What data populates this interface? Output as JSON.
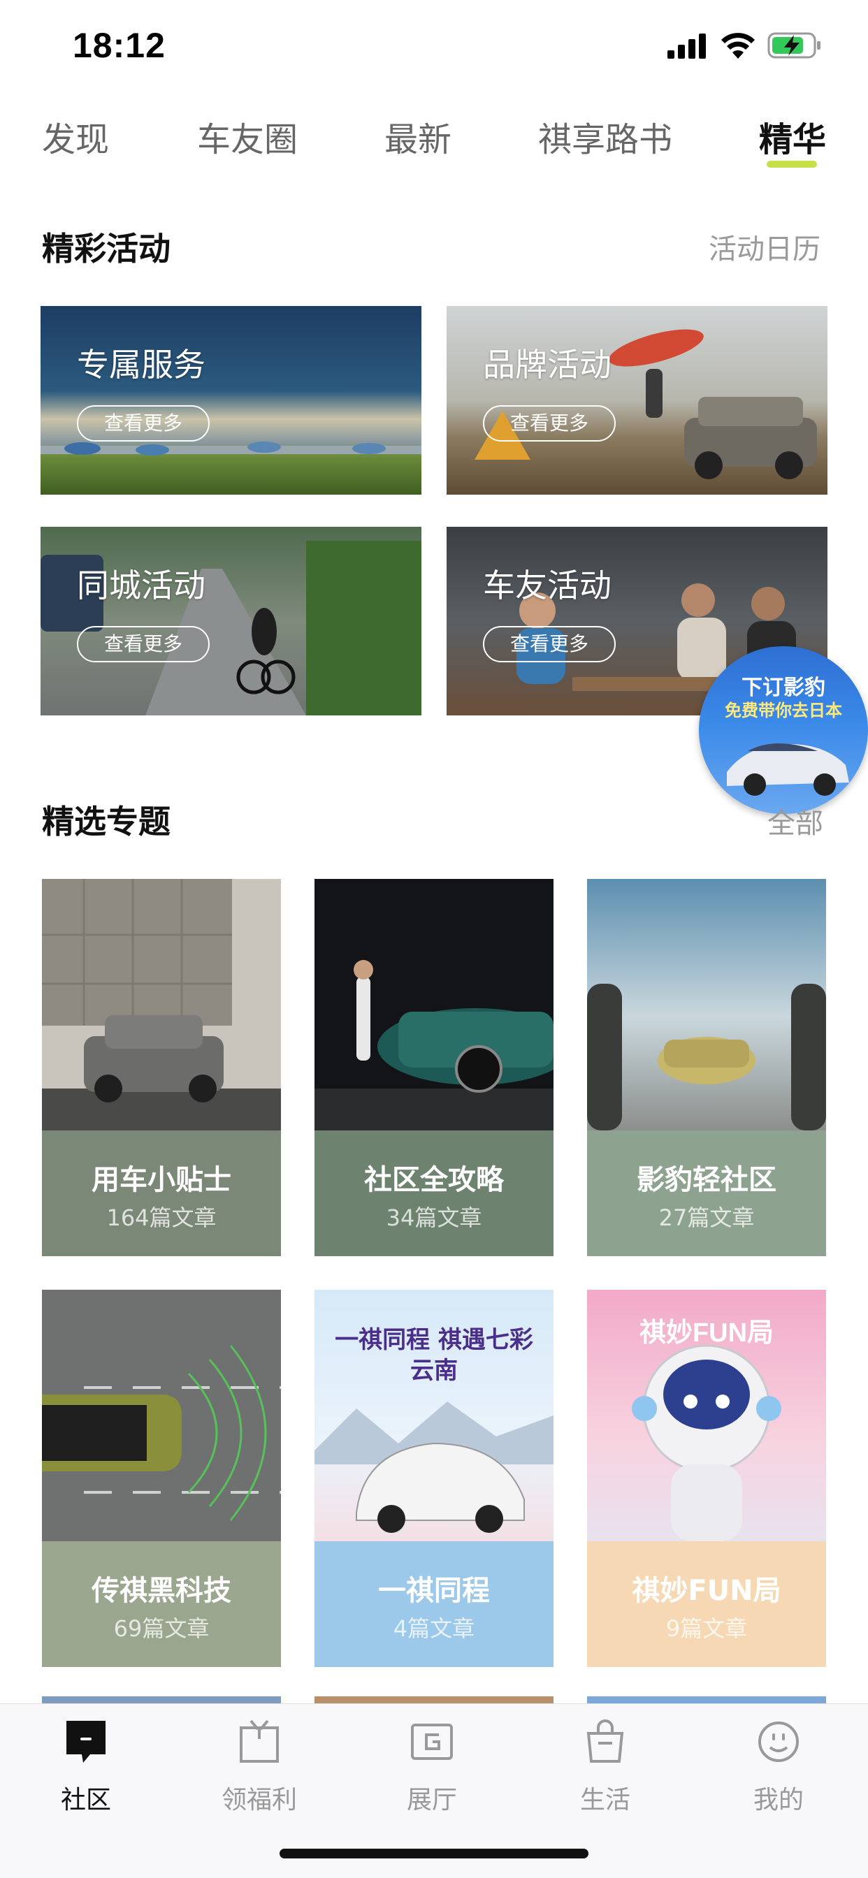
{
  "status_bar": {
    "time": "18:12"
  },
  "top_tabs": [
    {
      "label": "发现"
    },
    {
      "label": "车友圈"
    },
    {
      "label": "最新"
    },
    {
      "label": "祺享路书"
    },
    {
      "label": "精华",
      "active": true
    }
  ],
  "activities_section": {
    "title": "精彩活动",
    "link": "活动日历",
    "cards": [
      {
        "label": "专属服务",
        "more": "查看更多"
      },
      {
        "label": "品牌活动",
        "more": "查看更多"
      },
      {
        "label": "同城活动",
        "more": "查看更多"
      },
      {
        "label": "车友活动",
        "more": "查看更多"
      }
    ]
  },
  "floating_badge": {
    "line1": "下订影豹",
    "line2": "免费带你去日本"
  },
  "topics_section": {
    "title": "精选专题",
    "link": "全部",
    "cards": [
      {
        "name": "用车小贴士",
        "count": "164篇文章",
        "color": "#7b8777"
      },
      {
        "name": "社区全攻略",
        "count": "34篇文章",
        "color": "#6d8370"
      },
      {
        "name": "影豹轻社区",
        "count": "27篇文章",
        "color": "#8ea290"
      },
      {
        "name": "传祺黑科技",
        "count": "69篇文章",
        "color": "#9aa68d"
      },
      {
        "name": "一祺同程",
        "count": "4篇文章",
        "color": "#9cc8ea"
      },
      {
        "name": "祺妙FUN局",
        "count": "9篇文章",
        "color": "#f6d9b4"
      }
    ],
    "poster_text": {
      "topic5_title": "一祺同程 祺遇七彩云南",
      "topic6_title": "祺妙FUN局"
    }
  },
  "bottom_nav": [
    {
      "label": "社区",
      "icon": "community-icon",
      "active": true
    },
    {
      "label": "领福利",
      "icon": "gift-icon"
    },
    {
      "label": "展厅",
      "icon": "showroom-icon"
    },
    {
      "label": "生活",
      "icon": "shopping-bag-icon"
    },
    {
      "label": "我的",
      "icon": "profile-icon"
    }
  ],
  "colors": {
    "accent": "#c7e04a",
    "text_primary": "#111111",
    "text_secondary": "#999999"
  }
}
